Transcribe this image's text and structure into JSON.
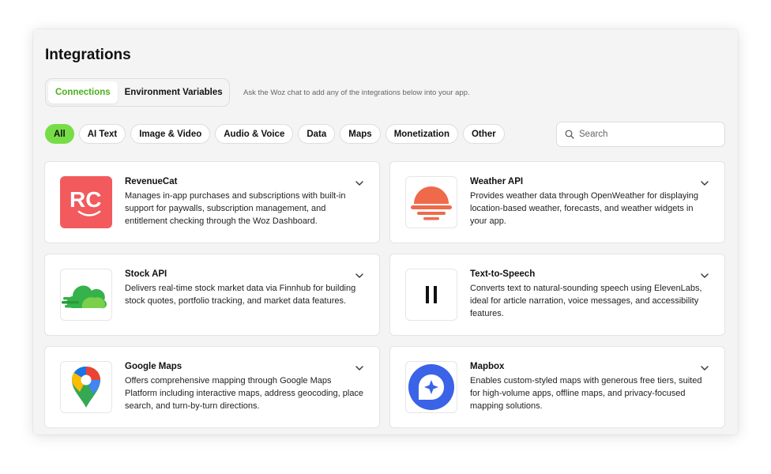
{
  "page": {
    "title": "Integrations"
  },
  "tabs": {
    "connections": "Connections",
    "environment_variables": "Environment Variables"
  },
  "hint": "Ask the Woz chat to add any of the integrations below into your app.",
  "filters": [
    "All",
    "AI Text",
    "Image & Video",
    "Audio & Voice",
    "Data",
    "Maps",
    "Monetization",
    "Other"
  ],
  "active_filter": "All",
  "search": {
    "placeholder": "Search",
    "value": ""
  },
  "colors": {
    "accent_green": "#77dd47",
    "active_tab_text": "#4caf1f",
    "revenuecat_red": "#f25a5e",
    "weather_orange": "#ee6a4b",
    "mapbox_blue": "#3b63e8"
  },
  "cards": [
    {
      "title": "RevenueCat",
      "description": "Manages in-app purchases and subscriptions with built-in support for paywalls, subscription management, and entitlement checking through the Woz Dashboard.",
      "icon": "revenuecat-logo",
      "logo_text": "RC"
    },
    {
      "title": "Weather API",
      "description": "Provides weather data through OpenWeather for displaying location-based weather, forecasts, and weather widgets in your app.",
      "icon": "openweather-logo"
    },
    {
      "title": "Stock API",
      "description": "Delivers real-time stock market data via Finnhub for building stock quotes, portfolio tracking, and market data features.",
      "icon": "finnhub-logo"
    },
    {
      "title": "Text-to-Speech",
      "description": "Converts text to natural-sounding speech using ElevenLabs, ideal for article narration, voice messages, and accessibility features.",
      "icon": "elevenlabs-logo"
    },
    {
      "title": "Google Maps",
      "description": "Offers comprehensive mapping through Google Maps Platform including interactive maps, address geocoding, place search, and turn-by-turn directions.",
      "icon": "google-maps-logo"
    },
    {
      "title": "Mapbox",
      "description": "Enables custom-styled maps with generous free tiers, suited for high-volume apps, offline maps, and privacy-focused mapping solutions.",
      "icon": "mapbox-logo"
    }
  ]
}
